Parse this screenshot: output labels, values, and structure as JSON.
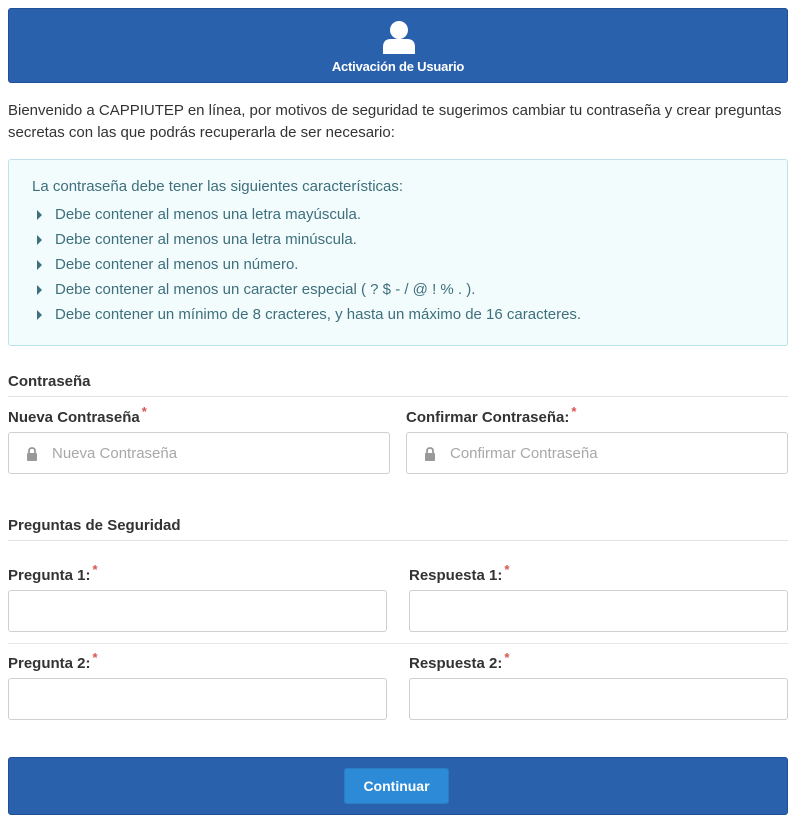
{
  "header": {
    "icon": "user-icon",
    "title": "Activación de Usuario"
  },
  "intro_text": "Bienvenido a CAPPIUTEP en línea, por motivos de seguridad te sugerimos cambiar tu contraseña y crear preguntas secretas con las que podrás recuperarla de ser necesario:",
  "password_rules": {
    "title": "La contraseña debe tener las siguientes características:",
    "items": [
      "Debe contener al menos una letra mayúscula.",
      "Debe contener al menos una letra minúscula.",
      "Debe contener al menos un número.",
      "Debe contener al menos un caracter especial ( ? $ - / @ ! % . ).",
      "Debe contener un mínimo de 8 cracteres, y hasta un máximo de 16 caracteres."
    ]
  },
  "password_section": {
    "title": "Contraseña",
    "new_password": {
      "label": "Nueva Contraseña",
      "required": "*",
      "placeholder": "Nueva Contraseña",
      "value": ""
    },
    "confirm_password": {
      "label": "Confirmar Contraseña:",
      "required": "*",
      "placeholder": "Confirmar Contraseña",
      "value": ""
    }
  },
  "security_section": {
    "title": "Preguntas de Seguridad",
    "question1": {
      "label": "Pregunta 1:",
      "required": "*",
      "value": ""
    },
    "answer1": {
      "label": "Respuesta 1:",
      "required": "*",
      "value": ""
    },
    "question2": {
      "label": "Pregunta 2:",
      "required": "*",
      "value": ""
    },
    "answer2": {
      "label": "Respuesta 2:",
      "required": "*",
      "value": ""
    }
  },
  "footer": {
    "continue_label": "Continuar"
  },
  "colors": {
    "primary": "#2a61ad",
    "button": "#2d8ad6",
    "info_bg": "#f3fcfd",
    "info_text": "#3d6f7c",
    "required": "#d9534f"
  }
}
